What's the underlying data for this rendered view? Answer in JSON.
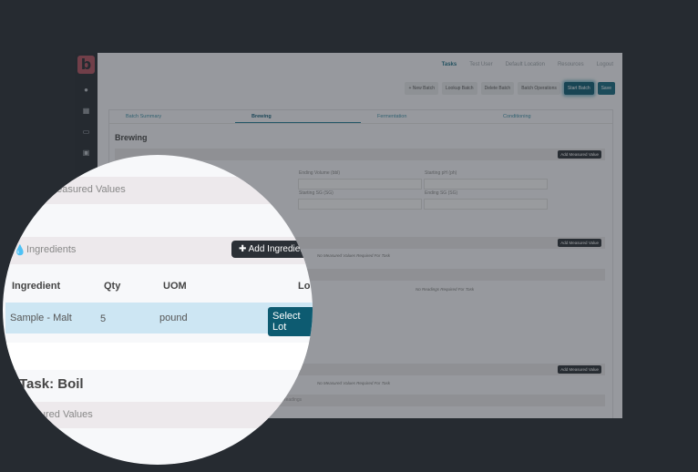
{
  "nav": {
    "tasks": "Tasks",
    "user": "Test User",
    "location": "Default Location",
    "resources": "Resources",
    "logout": "Logout"
  },
  "toolbar": {
    "new_batch": "+ New Batch",
    "lookup_batch": "Lookup Batch",
    "delete_batch": "Delete Batch",
    "batch_operations": "Batch Operations",
    "start_batch": "Start Batch",
    "save": "Save"
  },
  "tabs": [
    "Batch Summary",
    "Brewing",
    "Fermentation",
    "Conditioning"
  ],
  "page_title": "Brewing",
  "fields": {
    "ending_volume": "Ending Volume (bbl)",
    "starting_ph": "Starting pH (ph)",
    "starting_sg": "Starting SG (SG)",
    "ending_sg": "Ending SG (SG)"
  },
  "add_measured_value": "Add Measured Value",
  "no_measured_values": "No Measured Values Required For Task",
  "readings": "Readings",
  "no_readings": "No Readings Required For Task",
  "lens": {
    "measured_values": "Measured Values",
    "ingredients": "Ingredients",
    "add_ingredient": "Add Ingredient",
    "columns": [
      "Ingredient",
      "Qty",
      "UOM",
      "Lot"
    ],
    "row": {
      "ingredient": "Sample - Malt",
      "qty": "5",
      "uom": "pound",
      "lot_button": "Select Lot"
    },
    "task_title": "Task: Boil",
    "measured_values_2": "Measured Values"
  }
}
